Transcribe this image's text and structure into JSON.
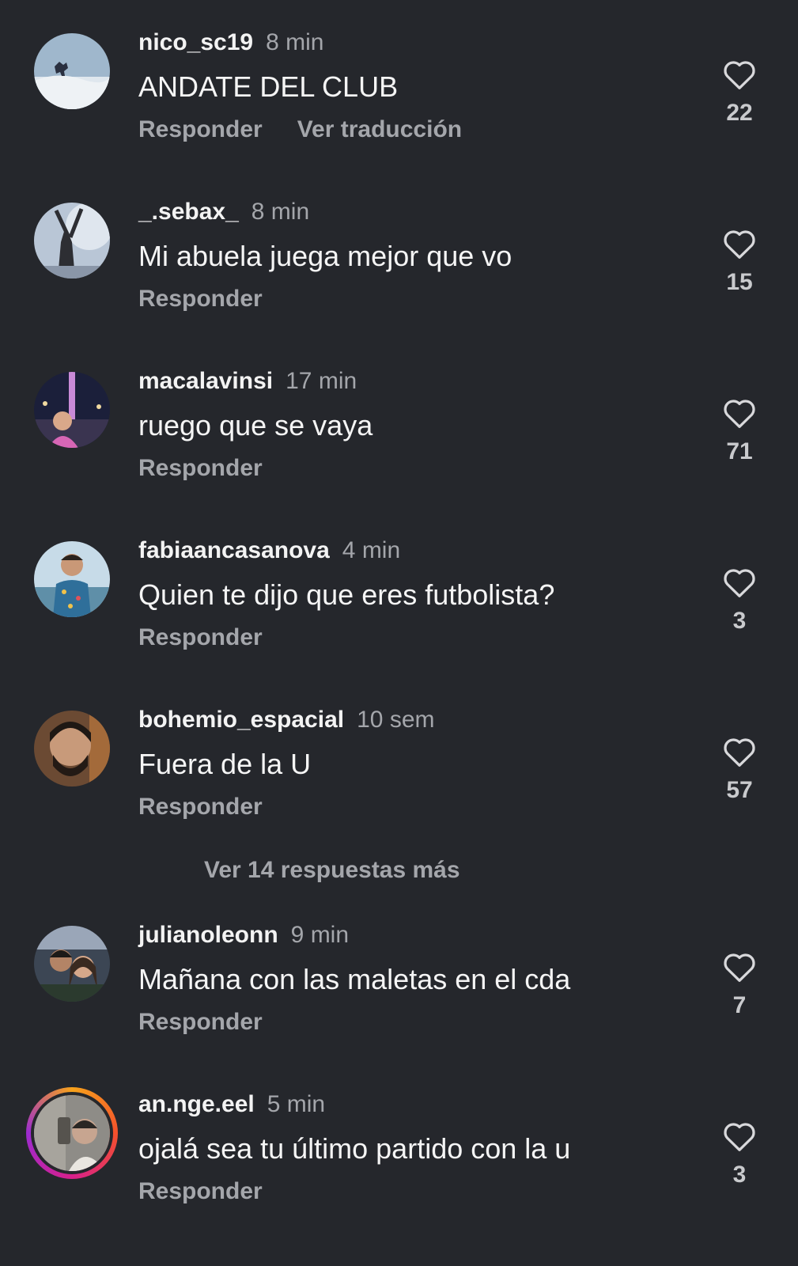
{
  "comments": [
    {
      "username": "nico_sc19",
      "time": "8 min",
      "text": "ANDATE DEL CLUB",
      "reply": "Responder",
      "translate": "Ver traducción",
      "likes": "22"
    },
    {
      "username": "_.sebax_",
      "time": "8 min",
      "text": "Mi abuela juega mejor que vo",
      "reply": "Responder",
      "likes": "15"
    },
    {
      "username": "macalavinsi",
      "time": "17 min",
      "text": "ruego que se vaya",
      "reply": "Responder",
      "likes": "71"
    },
    {
      "username": "fabiaancasanova",
      "time": "4 min",
      "text": "Quien te dijo que eres futbolista?",
      "reply": "Responder",
      "likes": "3"
    },
    {
      "username": "bohemio_espacial",
      "time": "10 sem",
      "text": "Fuera de la U",
      "reply": "Responder",
      "likes": "57"
    },
    {
      "username": "julianoleonn",
      "time": "9 min",
      "text": "Mañana con las maletas en el cda",
      "reply": "Responder",
      "likes": "7"
    },
    {
      "username": "an.nge.eel",
      "time": "5 min",
      "text": "ojalá sea tu último partido con la u",
      "reply": "Responder",
      "likes": "3"
    }
  ],
  "more_replies": "Ver 14 respuestas más",
  "icons": {
    "like": "heart-outline-icon"
  },
  "colors": {
    "background": "#25272c",
    "muted": "#a4a6ab",
    "text": "#f3f3f3"
  }
}
